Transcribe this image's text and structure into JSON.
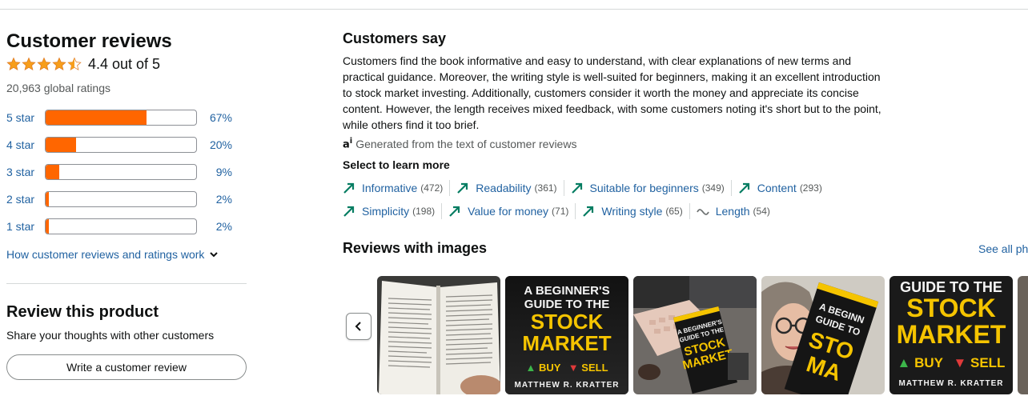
{
  "reviews": {
    "title": "Customer reviews",
    "rating": 4.4,
    "rating_text": "4.4 out of 5",
    "global_ratings": "20,963 global ratings",
    "histogram": [
      {
        "label": "5 star",
        "pct_text": "67%",
        "pct": 67
      },
      {
        "label": "4 star",
        "pct_text": "20%",
        "pct": 20
      },
      {
        "label": "3 star",
        "pct_text": "9%",
        "pct": 9
      },
      {
        "label": "2 star",
        "pct_text": "2%",
        "pct": 2
      },
      {
        "label": "1 star",
        "pct_text": "2%",
        "pct": 2
      }
    ],
    "how_link": "How customer reviews and ratings work"
  },
  "review_product": {
    "title": "Review this product",
    "subtitle": "Share your thoughts with other customers",
    "button": "Write a customer review"
  },
  "customers_say": {
    "title": "Customers say",
    "body": "Customers find the book informative and easy to understand, with clear explanations of new terms and practical guidance. Moreover, the writing style is well-suited for beginners, making it an excellent introduction to stock market investing. Additionally, customers consider it worth the money and appreciate its concise content. However, the length receives mixed feedback, with some customers noting it's short but to the point, while others find it too brief.",
    "generated": "Generated from the text of customer reviews",
    "learn_more": "Select to learn more",
    "aspects_row1": [
      {
        "label": "Informative",
        "count": "(472)",
        "icon": "trend-up-icon"
      },
      {
        "label": "Readability",
        "count": "(361)",
        "icon": "trend-up-icon"
      },
      {
        "label": "Suitable for beginners",
        "count": "(349)",
        "icon": "trend-up-icon"
      },
      {
        "label": "Content",
        "count": "(293)",
        "icon": "trend-up-icon"
      }
    ],
    "aspects_row2": [
      {
        "label": "Simplicity",
        "count": "(198)",
        "icon": "trend-up-icon"
      },
      {
        "label": "Value for money",
        "count": "(71)",
        "icon": "trend-up-icon"
      },
      {
        "label": "Writing style",
        "count": "(65)",
        "icon": "trend-up-icon"
      },
      {
        "label": "Length",
        "count": "(54)",
        "icon": "mixed-wave-icon"
      }
    ]
  },
  "reviews_with_images": {
    "title": "Reviews with images",
    "see_all": "See all ph",
    "thumbs": [
      {
        "kind": "open-book"
      },
      {
        "kind": "cover",
        "line1": "A BEGINNER'S",
        "line2": "GUIDE TO THE",
        "line3": "STOCK",
        "line4": "MARKET",
        "buy": "BUY",
        "sell": "SELL",
        "author": "MATTHEW R. KRATTER"
      },
      {
        "kind": "desk"
      },
      {
        "kind": "selfie"
      },
      {
        "kind": "cover2",
        "line1": "GUIDE TO THE",
        "line2": "STOCK",
        "line3": "MARKET",
        "buy": "BUY",
        "sell": "SELL",
        "author": "MATTHEW R. KRATTER"
      }
    ]
  },
  "colors": {
    "bar_fill": "#ff6600",
    "star": "#f79e1b",
    "link": "#2162a1",
    "trend_up": "#067d62"
  }
}
